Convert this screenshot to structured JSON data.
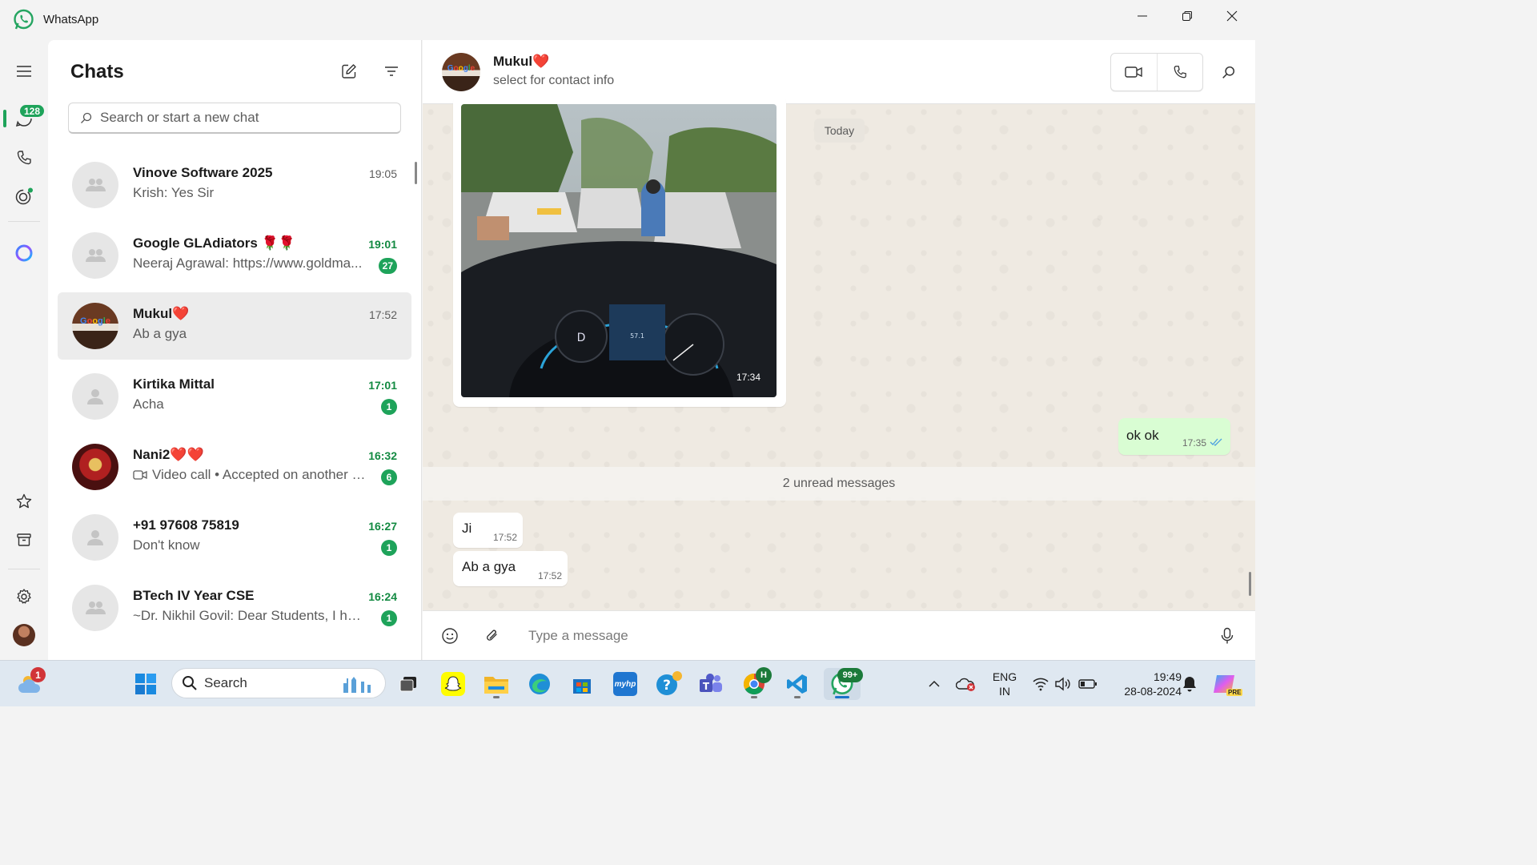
{
  "window": {
    "title": "WhatsApp"
  },
  "rail": {
    "chats_badge": "128"
  },
  "chatlist": {
    "title": "Chats",
    "search_placeholder": "Search or start a new chat",
    "chats": [
      {
        "name": "Vinove Software 2025",
        "preview": "Krish: Yes Sir",
        "time": "19:05",
        "unread": ""
      },
      {
        "name": "Google GLAdiators 🌹🌹",
        "preview": "Neeraj Agrawal: https://www.goldma...",
        "time": "19:01",
        "unread": "27"
      },
      {
        "name": "Mukul❤️",
        "preview": "Ab a gya",
        "time": "17:52",
        "unread": ""
      },
      {
        "name": "Kirtika Mittal",
        "preview": "Acha",
        "time": "17:01",
        "unread": "1"
      },
      {
        "name": "Nani2❤️❤️",
        "preview": "Video call • Accepted on another d...",
        "time": "16:32",
        "unread": "6"
      },
      {
        "name": "+91 97608 75819",
        "preview": "Don't know",
        "time": "16:27",
        "unread": "1"
      },
      {
        "name": "BTech IV Year CSE",
        "preview": "~Dr. Nikhil Govil: Dear Students, I hop...",
        "time": "16:24",
        "unread": "1"
      }
    ]
  },
  "conversation": {
    "contact_name": "Mukul❤️",
    "contact_sub": "select for contact info",
    "date_divider": "Today",
    "image_time": "17:34",
    "sent_message": {
      "text": "ok ok",
      "time": "17:35"
    },
    "unread_divider": "2 unread messages",
    "received": [
      {
        "text": "Ji",
        "time": "17:52"
      },
      {
        "text": "Ab a gya",
        "time": "17:52"
      }
    ],
    "composer_placeholder": "Type a message"
  },
  "taskbar": {
    "weather_badge": "1",
    "search_label": "Search",
    "whatsapp_badge": "99+",
    "chrome_badge": "H",
    "lang_line1": "ENG",
    "lang_line2": "IN",
    "clock_time": "19:49",
    "clock_date": "28-08-2024",
    "myhp_label": "myhp",
    "copilot_label": "PRE"
  },
  "colors": {
    "accent": "#1ea35a",
    "bubble_out": "#d9fdd3",
    "chat_bg": "#efeae2"
  }
}
